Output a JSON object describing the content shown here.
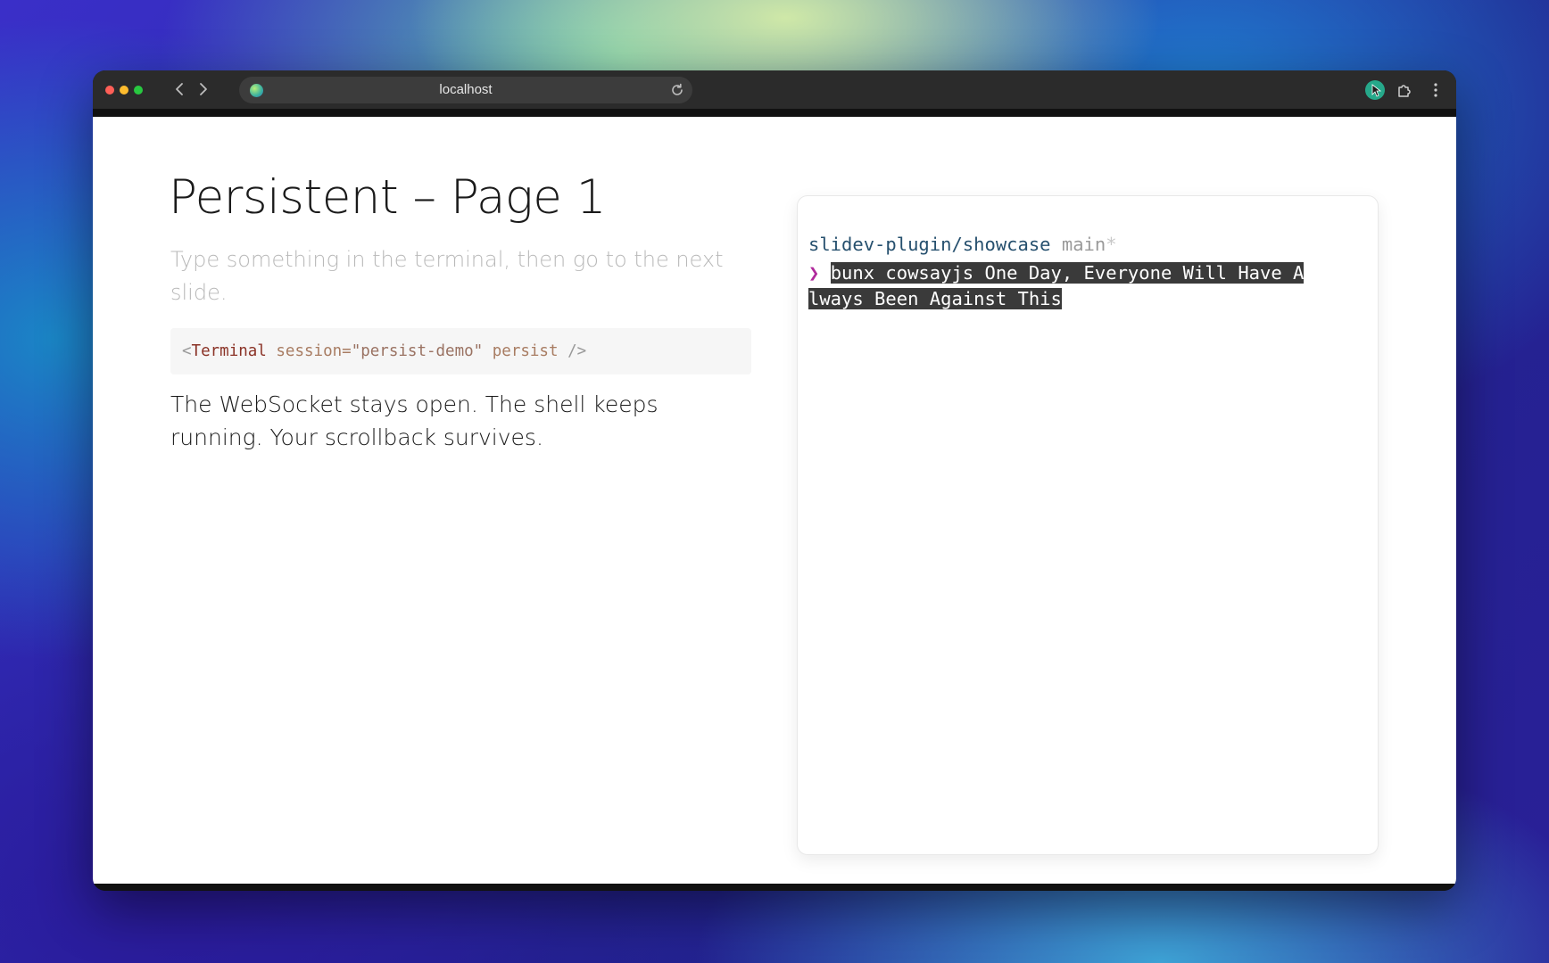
{
  "browser": {
    "url": "localhost"
  },
  "slide": {
    "title": "Persistent – Page 1",
    "subtitle": "Type something in the terminal, then go to the next slide.",
    "code": {
      "open": "<",
      "tag": "Terminal",
      "attr_session": "session=",
      "session_value": "\"persist-demo\"",
      "attr_persist": "persist",
      "close": "/>"
    },
    "body": "The WebSocket stays open. The shell keeps running. Your scrollback survives."
  },
  "terminal": {
    "path": "slidev-plugin/showcase",
    "branch": "main",
    "dirty_marker": "*",
    "prompt": "❯",
    "command_line1": "bunx cowsayjs One Day, Everyone Will Have A",
    "command_line2": "lways Been Against This"
  },
  "colors": {
    "prompt": "#b02a9c",
    "path": "#26506e",
    "selection": "#3a3a3a"
  },
  "icons": [
    "back-icon",
    "forward-icon",
    "site-icon",
    "reload-icon",
    "profile-icon",
    "extensions-icon",
    "menu-icon"
  ]
}
